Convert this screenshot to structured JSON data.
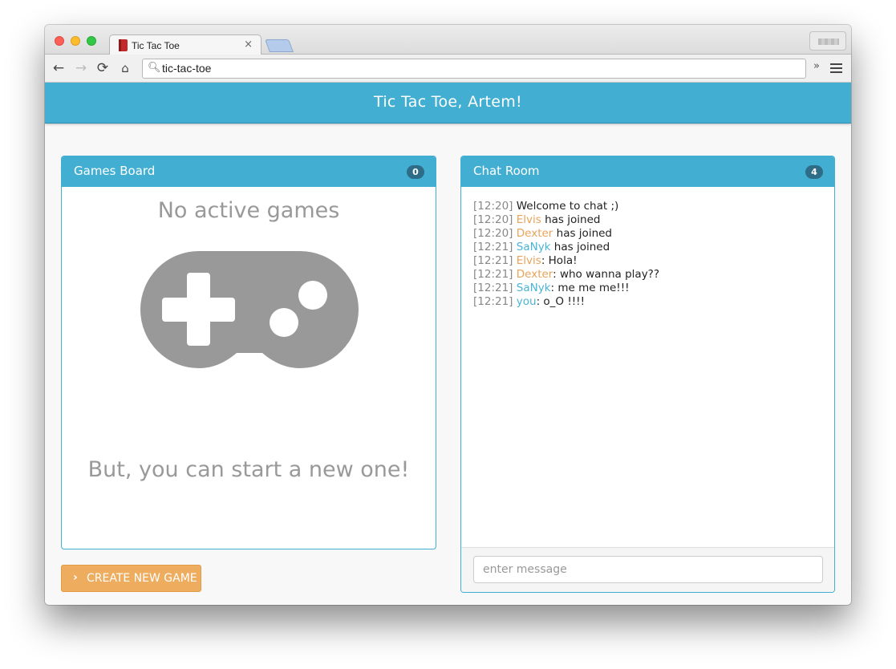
{
  "browser": {
    "tab_title": "Tic Tac Toe",
    "tab_close": "×",
    "address": "tic-tac-toe",
    "nav": {
      "back": "←",
      "forward": "→",
      "reload": "⟳",
      "home": "⌂",
      "extensions": "»"
    }
  },
  "header": {
    "title": "Tic Tac Toe, Artem!"
  },
  "games_board": {
    "title": "Games Board",
    "count": "0",
    "empty_title": "No active games",
    "empty_subtitle": "But, you can start a new one!",
    "icon": "gamepad-icon",
    "icon_color": "#999999"
  },
  "create_button": {
    "icon": "chevron-right-icon",
    "chevron": "›",
    "label": "CREATE NEW GAME",
    "color": "#edac5e"
  },
  "chat_room": {
    "title": "Chat Room",
    "count": "4",
    "messages": [
      {
        "time": "[12:20]",
        "user": "",
        "user_color": "",
        "text": "Welcome to chat ;)"
      },
      {
        "time": "[12:20]",
        "user": "Elvis",
        "user_color": "orange",
        "text": " has joined"
      },
      {
        "time": "[12:20]",
        "user": "Dexter",
        "user_color": "orange",
        "text": " has joined"
      },
      {
        "time": "[12:21]",
        "user": "SaNyk",
        "user_color": "blue",
        "text": " has joined"
      },
      {
        "time": "[12:21]",
        "user": "Elvis",
        "user_color": "orange",
        "text": ": Hola!"
      },
      {
        "time": "[12:21]",
        "user": "Dexter",
        "user_color": "orange",
        "text": ": who wanna play??"
      },
      {
        "time": "[12:21]",
        "user": "SaNyk",
        "user_color": "blue",
        "text": ": me me me!!!"
      },
      {
        "time": "[12:21]",
        "user": "you",
        "user_color": "blue",
        "text": ": o_O !!!!"
      }
    ],
    "input_value": "",
    "input_placeholder": "enter message"
  },
  "colors": {
    "primary": "#42aed1",
    "badge": "#2f6c87",
    "orange_user": "#e9a35a",
    "blue_user": "#4ab4d6"
  }
}
